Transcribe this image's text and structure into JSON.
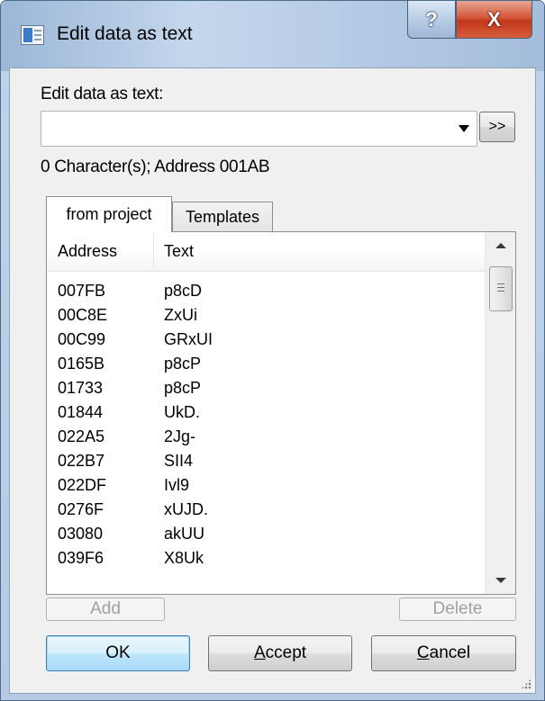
{
  "window": {
    "title": "Edit data as text",
    "help_label": "?",
    "close_label": "X"
  },
  "editor": {
    "label": "Edit data as text:",
    "input_value": "",
    "more_label": ">>",
    "status": "0 Character(s); Address 001AB"
  },
  "tabs": [
    {
      "label": "from project",
      "active": true
    },
    {
      "label": "Templates",
      "active": false
    }
  ],
  "list": {
    "columns": [
      "Address",
      "Text"
    ],
    "rows": [
      {
        "address": "007FB",
        "text": "p8cD"
      },
      {
        "address": "00C8E",
        "text": "ZxUi"
      },
      {
        "address": "00C99",
        "text": "GRxUI"
      },
      {
        "address": "0165B",
        "text": "p8cP"
      },
      {
        "address": "01733",
        "text": "p8cP"
      },
      {
        "address": "01844",
        "text": "UkD."
      },
      {
        "address": "022A5",
        "text": "2Jg-"
      },
      {
        "address": "022B7",
        "text": "SII4"
      },
      {
        "address": "022DF",
        "text": "Ivl9"
      },
      {
        "address": "0276F",
        "text": "xUJD."
      },
      {
        "address": "03080",
        "text": "akUU"
      },
      {
        "address": "039F6",
        "text": "X8Uk"
      }
    ]
  },
  "buttons": {
    "add": "Add",
    "delete": "Delete",
    "ok": "OK",
    "accept": "Accept",
    "cancel": "Cancel"
  }
}
